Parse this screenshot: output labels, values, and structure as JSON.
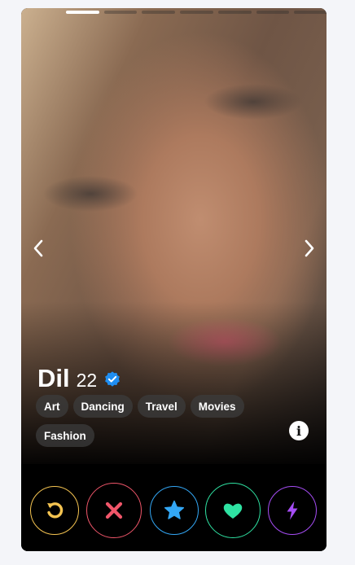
{
  "profile": {
    "name": "Dil",
    "age": "22",
    "verified": true,
    "interests": [
      "Art",
      "Dancing",
      "Travel",
      "Movies",
      "Fashion"
    ],
    "photo_count": 7,
    "current_photo_index": 1
  },
  "icons": {
    "prev": "chevron-left-icon",
    "next": "chevron-right-icon",
    "info": "info-icon",
    "verified": "verified-badge-icon"
  },
  "actions": [
    {
      "id": "rewind",
      "icon": "rewind-icon",
      "color": "#f5c451"
    },
    {
      "id": "nope",
      "icon": "close-icon",
      "color": "#f0566a"
    },
    {
      "id": "super-like",
      "icon": "star-icon",
      "color": "#33a7f5"
    },
    {
      "id": "like",
      "icon": "heart-icon",
      "color": "#2fe3a3"
    },
    {
      "id": "boost",
      "icon": "lightning-icon",
      "color": "#a64df5"
    }
  ],
  "info_glyph": "i"
}
